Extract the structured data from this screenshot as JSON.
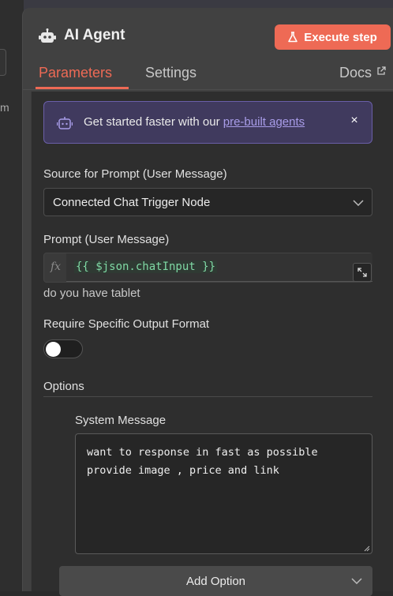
{
  "node": {
    "title": "AI Agent",
    "execute_label": "Execute step",
    "accent_color": "#ee6a55"
  },
  "tabs": [
    {
      "label": "Parameters",
      "active": true
    },
    {
      "label": "Settings",
      "active": false
    }
  ],
  "docs_label": "Docs",
  "banner": {
    "text": "Get started faster with our ",
    "link_text": "pre-built agents",
    "close": "×"
  },
  "source_prompt": {
    "label": "Source for Prompt (User Message)",
    "value": "Connected Chat Trigger Node"
  },
  "prompt": {
    "label": "Prompt (User Message)",
    "fx": "fx",
    "expression": "{{ $json.chatInput }}",
    "resolved_hint": "do you have tablet"
  },
  "output_format": {
    "label": "Require Specific Output Format",
    "enabled": false
  },
  "options": {
    "label": "Options",
    "system_message_label": "System Message",
    "system_message": "want to response in fast as possible\nprovide image , price and link",
    "add_option_label": "Add Option"
  },
  "background": {
    "left_char": "m"
  }
}
